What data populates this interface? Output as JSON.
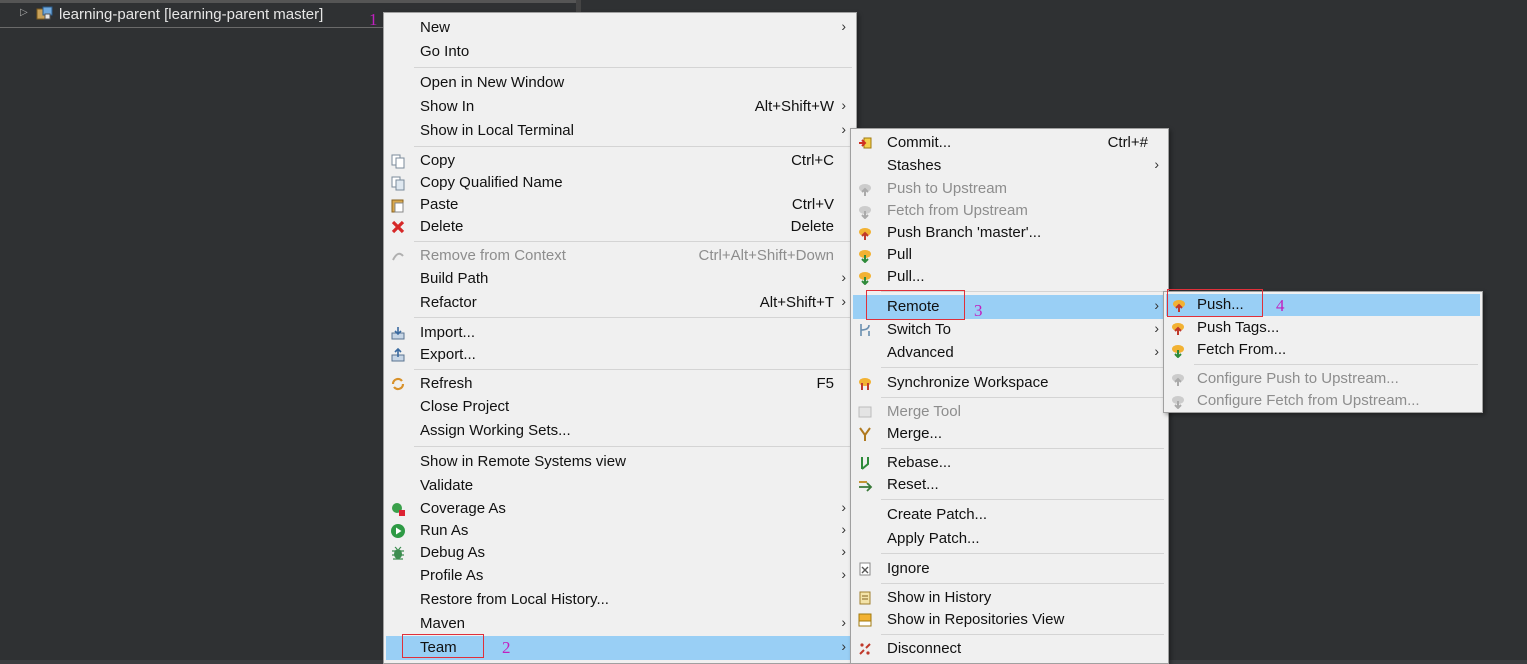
{
  "tree": {
    "project_label": "learning-parent [learning-parent master]"
  },
  "markers": {
    "m1": "1",
    "m2": "2",
    "m3": "3",
    "m4": "4"
  },
  "context_menu": {
    "new": "New",
    "go_into": "Go Into",
    "open_new_window": "Open in New Window",
    "show_in": "Show In",
    "show_in_shortcut": "Alt+Shift+W",
    "show_local_terminal": "Show in Local Terminal",
    "copy": "Copy",
    "copy_shortcut": "Ctrl+C",
    "copy_qualified": "Copy Qualified Name",
    "paste": "Paste",
    "paste_shortcut": "Ctrl+V",
    "delete": "Delete",
    "delete_shortcut": "Delete",
    "remove_context": "Remove from Context",
    "remove_context_shortcut": "Ctrl+Alt+Shift+Down",
    "build_path": "Build Path",
    "refactor": "Refactor",
    "refactor_shortcut": "Alt+Shift+T",
    "import": "Import...",
    "export": "Export...",
    "refresh": "Refresh",
    "refresh_shortcut": "F5",
    "close_project": "Close Project",
    "assign_working_sets": "Assign Working Sets...",
    "show_remote_systems": "Show in Remote Systems view",
    "validate": "Validate",
    "coverage_as": "Coverage As",
    "run_as": "Run As",
    "debug_as": "Debug As",
    "profile_as": "Profile As",
    "restore_history": "Restore from Local History...",
    "maven": "Maven",
    "team": "Team"
  },
  "team_menu": {
    "commit": "Commit...",
    "commit_shortcut": "Ctrl+#",
    "stashes": "Stashes",
    "push_upstream": "Push to Upstream",
    "fetch_upstream": "Fetch from Upstream",
    "push_branch": "Push Branch 'master'...",
    "pull": "Pull",
    "pull_dialog": "Pull...",
    "remote": "Remote",
    "switch_to": "Switch To",
    "advanced": "Advanced",
    "sync_workspace": "Synchronize Workspace",
    "merge_tool": "Merge Tool",
    "merge": "Merge...",
    "rebase": "Rebase...",
    "reset": "Reset...",
    "create_patch": "Create Patch...",
    "apply_patch": "Apply Patch...",
    "ignore": "Ignore",
    "show_history": "Show in History",
    "show_repositories": "Show in Repositories View",
    "disconnect": "Disconnect"
  },
  "remote_menu": {
    "push": "Push...",
    "push_tags": "Push Tags...",
    "fetch_from": "Fetch From...",
    "configure_push": "Configure Push to Upstream...",
    "configure_fetch": "Configure Fetch from Upstream..."
  },
  "icons": {
    "project": "project-folder-icon",
    "copy": "copy-icon",
    "paste": "paste-icon",
    "delete": "delete-icon",
    "refresh": "refresh-icon",
    "run": "run-icon",
    "debug": "debug-icon",
    "commit": "commit-icon",
    "push": "push-icon",
    "pull": "pull-icon"
  },
  "colors": {
    "highlight": "#99cff5",
    "menu_bg": "#f0f0f0",
    "marker": "#c020c0",
    "callout_box": "#e0303a",
    "workspace_bg": "#2f3133"
  }
}
